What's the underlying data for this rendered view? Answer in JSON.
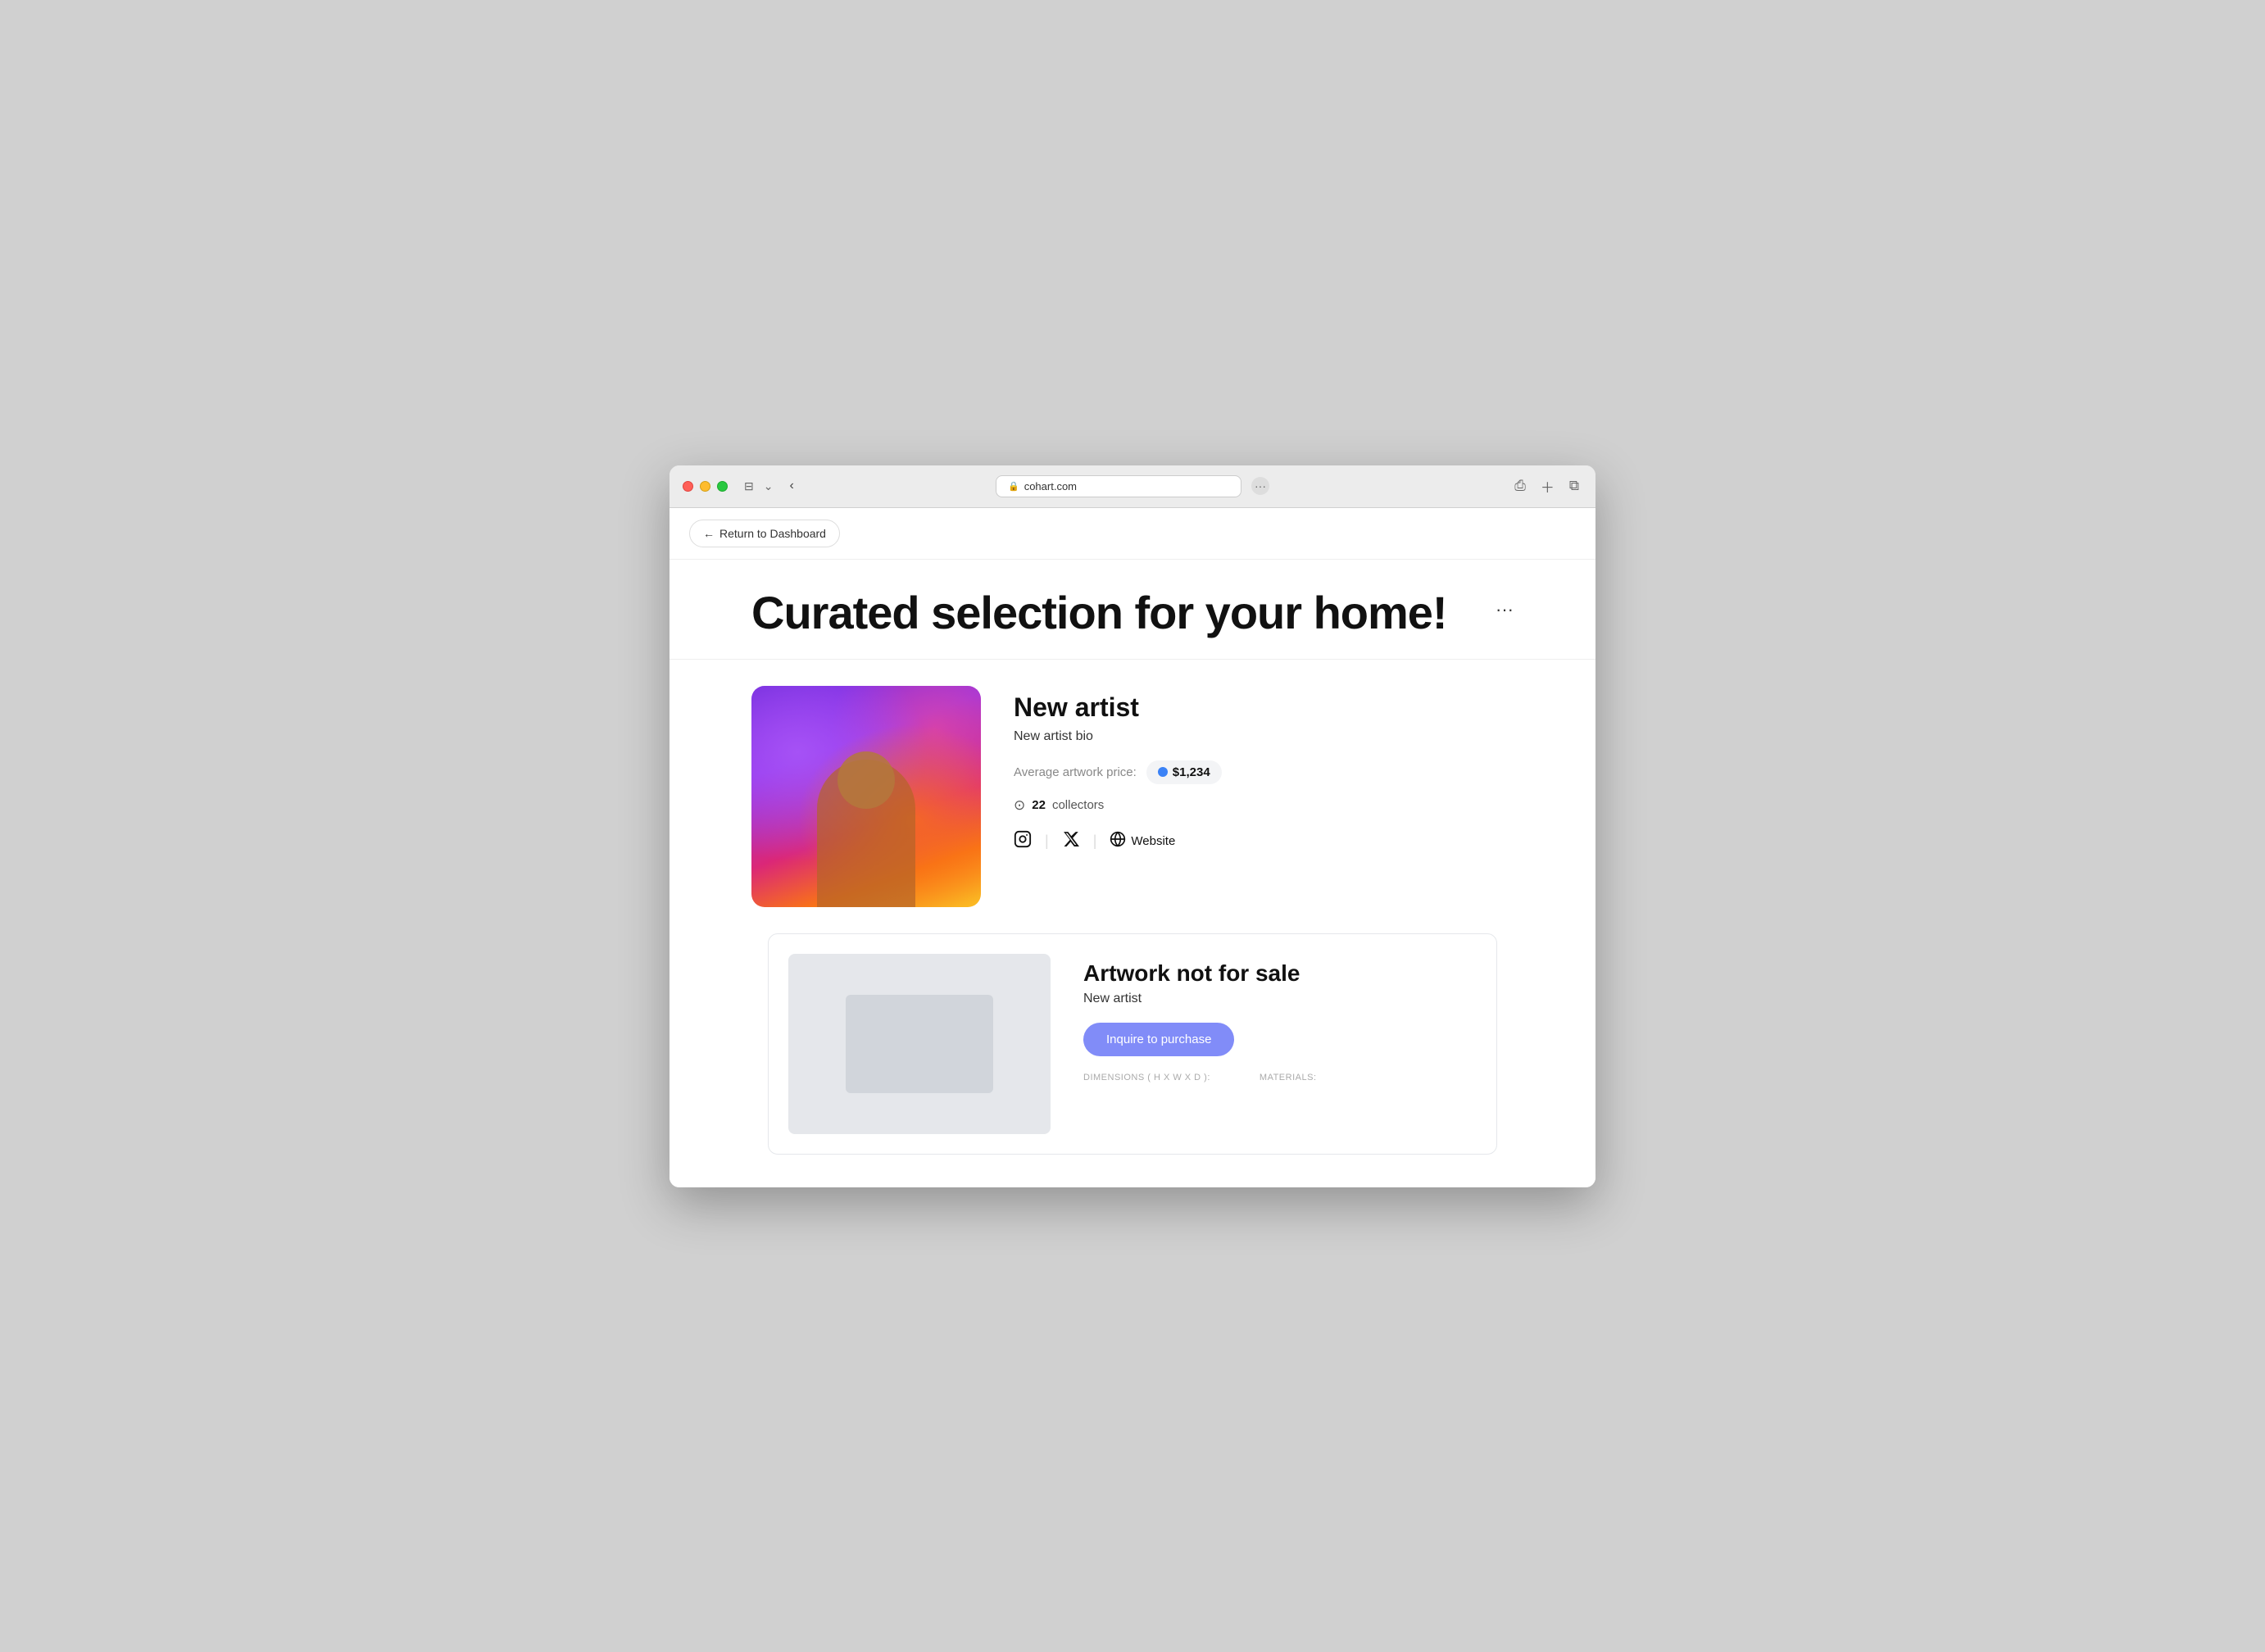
{
  "browser": {
    "url": "cohart.com",
    "lock_icon": "🔒",
    "more_icon": "···"
  },
  "nav": {
    "back_button_label": "Return to Dashboard",
    "back_arrow": "←"
  },
  "hero": {
    "title": "Curated selection for your home!",
    "more_icon": "···"
  },
  "artist": {
    "name": "New artist",
    "bio": "New artist bio",
    "price_label": "Average artwork price:",
    "price": "$1,234",
    "collectors_count": "22",
    "collectors_label": "collectors",
    "collectors_icon": "⊙",
    "website_label": "Website"
  },
  "artwork": {
    "title": "Artwork not for sale",
    "artist_name": "New artist",
    "inquire_button": "Inquire to purchase",
    "dimensions_label": "DIMENSIONS ( H X W X D ):",
    "materials_label": "MATERIALS:"
  }
}
